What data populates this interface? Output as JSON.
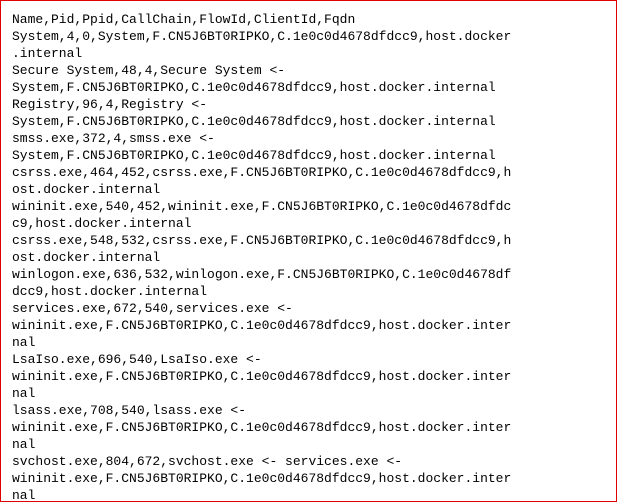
{
  "lines": [
    "Name,Pid,Ppid,CallChain,FlowId,ClientId,Fqdn",
    "System,4,0,System,F.CN5J6BT0RIPKO,C.1e0c0d4678dfdcc9,host.docker",
    ".internal",
    "Secure System,48,4,Secure System <-",
    "System,F.CN5J6BT0RIPKO,C.1e0c0d4678dfdcc9,host.docker.internal",
    "Registry,96,4,Registry <-",
    "System,F.CN5J6BT0RIPKO,C.1e0c0d4678dfdcc9,host.docker.internal",
    "smss.exe,372,4,smss.exe <-",
    "System,F.CN5J6BT0RIPKO,C.1e0c0d4678dfdcc9,host.docker.internal",
    "csrss.exe,464,452,csrss.exe,F.CN5J6BT0RIPKO,C.1e0c0d4678dfdcc9,h",
    "ost.docker.internal",
    "wininit.exe,540,452,wininit.exe,F.CN5J6BT0RIPKO,C.1e0c0d4678dfdc",
    "c9,host.docker.internal",
    "csrss.exe,548,532,csrss.exe,F.CN5J6BT0RIPKO,C.1e0c0d4678dfdcc9,h",
    "ost.docker.internal",
    "winlogon.exe,636,532,winlogon.exe,F.CN5J6BT0RIPKO,C.1e0c0d4678df",
    "dcc9,host.docker.internal",
    "services.exe,672,540,services.exe <-",
    "wininit.exe,F.CN5J6BT0RIPKO,C.1e0c0d4678dfdcc9,host.docker.inter",
    "nal",
    "LsaIso.exe,696,540,LsaIso.exe <-",
    "wininit.exe,F.CN5J6BT0RIPKO,C.1e0c0d4678dfdcc9,host.docker.inter",
    "nal",
    "lsass.exe,708,540,lsass.exe <-",
    "wininit.exe,F.CN5J6BT0RIPKO,C.1e0c0d4678dfdcc9,host.docker.inter",
    "nal",
    "svchost.exe,804,672,svchost.exe <- services.exe <-",
    "wininit.exe,F.CN5J6BT0RIPKO,C.1e0c0d4678dfdcc9,host.docker.inter",
    "nal"
  ]
}
